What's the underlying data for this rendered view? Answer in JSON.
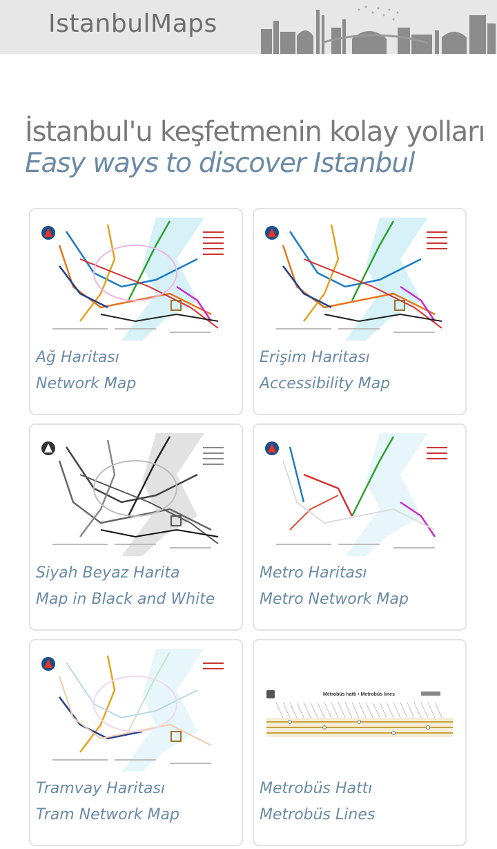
{
  "header": {
    "title": "IstanbulMaps"
  },
  "heading": {
    "tr": "İstanbul'u keşfetmenin kolay yolları",
    "en": "Easy ways to discover Istanbul"
  },
  "metrobus_thumb": {
    "title": "Metrobüs hattı • Metrobüs lines"
  },
  "cards": [
    {
      "label_tr": "Ağ Haritası",
      "label_en": "Network Map",
      "style": "color"
    },
    {
      "label_tr": "Erişim Haritası",
      "label_en": "Accessibility Map",
      "style": "color"
    },
    {
      "label_tr": "Siyah Beyaz Harita",
      "label_en": "Map in Black and White",
      "style": "bw"
    },
    {
      "label_tr": "Metro Haritası",
      "label_en": "Metro Network Map",
      "style": "metro"
    },
    {
      "label_tr": "Tramvay Haritası",
      "label_en": "Tram Network Map",
      "style": "tram"
    },
    {
      "label_tr": "Metrobüs Hattı",
      "label_en": "Metrobüs Lines",
      "style": "metrobus"
    }
  ]
}
